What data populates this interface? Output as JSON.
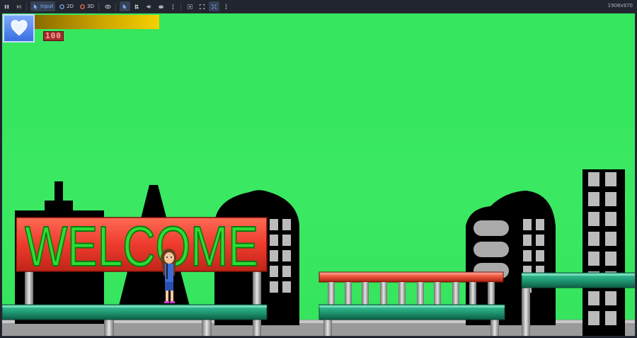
{
  "toolbar": {
    "pause_icon": "pause-icon",
    "step_icon": "step-forward-icon",
    "input_label": "Input",
    "mode_2d_label": "2D",
    "mode_3d_label": "3D",
    "resolution": "1908x970"
  },
  "hud": {
    "health_icon": "heart-icon",
    "health_fraction": 1.0,
    "score": "100"
  },
  "scene": {
    "sign_text": "WELCOME",
    "sky_color": "#38e660",
    "sign_color": "#ee3b2e",
    "sign_text_color": "#2fdc34"
  }
}
